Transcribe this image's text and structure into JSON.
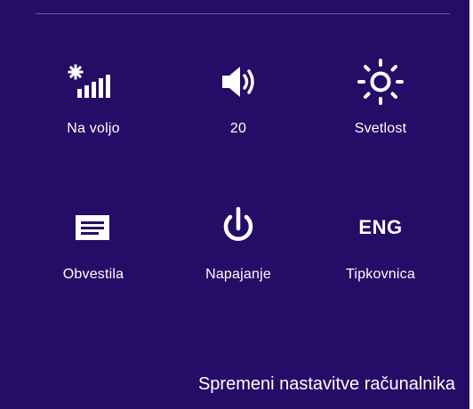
{
  "colors": {
    "panel_background": "#250d67",
    "text": "#ffffff",
    "divider": "#6b5aa6"
  },
  "settings": {
    "tiles": [
      {
        "label": "Na voljo",
        "icon": "wireless-signal-icon"
      },
      {
        "label": "20",
        "icon": "speaker-volume-icon"
      },
      {
        "label": "Svetlost",
        "icon": "brightness-sun-icon"
      },
      {
        "label": "Obvestila",
        "icon": "notifications-message-icon"
      },
      {
        "label": "Napajanje",
        "icon": "power-icon"
      },
      {
        "label": "Tipkovnica",
        "icon": "keyboard-language-icon",
        "icon_text": "ENG"
      }
    ],
    "change_pc_settings_link": "Spremeni nastavitve računalnika"
  }
}
